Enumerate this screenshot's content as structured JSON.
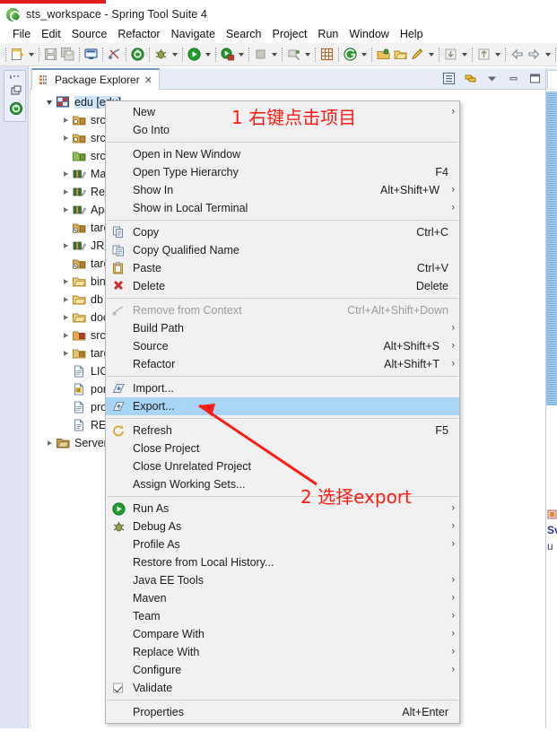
{
  "window": {
    "title": "sts_workspace - Spring Tool Suite 4",
    "app_icon": "spring-logo-icon"
  },
  "menubar": {
    "items": [
      "File",
      "Edit",
      "Source",
      "Refactor",
      "Navigate",
      "Search",
      "Project",
      "Run",
      "Window",
      "Help"
    ]
  },
  "toolbar": {
    "groups": [
      {
        "icons": [
          "new-wizard-icon"
        ],
        "arrow_after": true
      },
      {
        "icons": [
          "save-icon",
          "save-all-icon"
        ],
        "arrow_after": false
      },
      {
        "icons": [
          "console-icon"
        ],
        "arrow_after": false
      },
      {
        "icons": [
          "skip-breakpoints-icon"
        ],
        "arrow_after": false
      },
      {
        "icons": [
          "boot-dashboard-icon"
        ],
        "arrow_after": false
      },
      {
        "icons": [
          "debug-icon"
        ],
        "arrow_after": true
      },
      {
        "icons": [
          "run-icon"
        ],
        "arrow_after": true
      },
      {
        "icons": [
          "run-external-tools-icon"
        ],
        "arrow_after": true
      },
      {
        "icons": [
          "terminate-icon"
        ],
        "arrow_after": true
      },
      {
        "icons": [
          "publish-icon"
        ],
        "arrow_after": true
      },
      {
        "icons": [
          "new-package-icon"
        ],
        "arrow_after": false
      },
      {
        "icons": [
          "git-repo-icon"
        ],
        "arrow_after": true
      },
      {
        "icons": [
          "open-type-icon",
          "open-folder-icon",
          "search-pencil-icon"
        ],
        "arrow_after": true
      },
      {
        "icons": [
          "previous-annotation-icon"
        ],
        "arrow_after": true
      },
      {
        "icons": [
          "next-annotation-icon"
        ],
        "arrow_after": true
      },
      {
        "icons": [
          "back-icon",
          "forward-icon"
        ],
        "arrow_after": true
      },
      {
        "icons": [
          "last-edit-icon"
        ],
        "arrow_after": false
      }
    ]
  },
  "rail": {
    "items": [
      "restore-perspective-icon",
      "boot-dashboard-icon"
    ]
  },
  "explorer": {
    "tab_label": "Package Explorer",
    "tab_icon": "package-explorer-icon",
    "close_glyph": "✕",
    "view_tools": [
      "collapse-all-icon",
      "link-with-editor-icon",
      "view-menu-icon",
      "minimize-icon",
      "maximize-icon"
    ],
    "tree": [
      {
        "indent": 0,
        "twisty": "open",
        "icon": "java-project-icon",
        "label": "edu [edu]"
      },
      {
        "indent": 1,
        "twisty": "closed",
        "icon": "source-folder-icon",
        "label": "src/"
      },
      {
        "indent": 1,
        "twisty": "closed",
        "icon": "source-folder-icon",
        "label": "src/"
      },
      {
        "indent": 1,
        "twisty": "none",
        "icon": "source-folder-warn-icon",
        "label": "src/"
      },
      {
        "indent": 1,
        "twisty": "closed",
        "icon": "library-icon",
        "label": "Mav"
      },
      {
        "indent": 1,
        "twisty": "closed",
        "icon": "library-icon",
        "label": "Refe"
      },
      {
        "indent": 1,
        "twisty": "closed",
        "icon": "library-icon",
        "label": "Apa"
      },
      {
        "indent": 1,
        "twisty": "none",
        "icon": "source-folder-excl-icon",
        "label": "targ"
      },
      {
        "indent": 1,
        "twisty": "closed",
        "icon": "library-icon",
        "label": "JRE "
      },
      {
        "indent": 1,
        "twisty": "none",
        "icon": "source-folder-excl-icon",
        "label": "targ"
      },
      {
        "indent": 1,
        "twisty": "closed",
        "icon": "folder-icon",
        "label": "bin"
      },
      {
        "indent": 1,
        "twisty": "closed",
        "icon": "folder-icon",
        "label": "db"
      },
      {
        "indent": 1,
        "twisty": "closed",
        "icon": "folder-icon",
        "label": "doc"
      },
      {
        "indent": 1,
        "twisty": "closed",
        "icon": "folder-src-icon",
        "label": "src"
      },
      {
        "indent": 1,
        "twisty": "closed",
        "icon": "folder-excl-icon",
        "label": "targ"
      },
      {
        "indent": 1,
        "twisty": "none",
        "icon": "file-icon",
        "label": "LICE"
      },
      {
        "indent": 1,
        "twisty": "none",
        "icon": "pom-file-icon",
        "label": "pom"
      },
      {
        "indent": 1,
        "twisty": "none",
        "icon": "file-icon",
        "label": "prog"
      },
      {
        "indent": 1,
        "twisty": "none",
        "icon": "file-icon",
        "label": "REA"
      },
      {
        "indent": 0,
        "twisty": "closed",
        "icon": "servers-folder-icon",
        "label": "Servers"
      }
    ]
  },
  "right_panel": {
    "icon": "warning-file-icon",
    "line1": "Sv",
    "line2": "u"
  },
  "context_menu": {
    "items": [
      {
        "kind": "item",
        "label": "New",
        "accel": "",
        "submenu": true,
        "icon": "",
        "disabled": false
      },
      {
        "kind": "item",
        "label": "Go Into",
        "accel": "",
        "submenu": false,
        "icon": "",
        "disabled": false
      },
      {
        "kind": "sep"
      },
      {
        "kind": "item",
        "label": "Open in New Window",
        "accel": "",
        "submenu": false,
        "icon": "",
        "disabled": false
      },
      {
        "kind": "item",
        "label": "Open Type Hierarchy",
        "accel": "F4",
        "submenu": false,
        "icon": "",
        "disabled": false
      },
      {
        "kind": "item",
        "label": "Show In",
        "accel": "Alt+Shift+W",
        "submenu": true,
        "icon": "",
        "disabled": false
      },
      {
        "kind": "item",
        "label": "Show in Local Terminal",
        "accel": "",
        "submenu": true,
        "icon": "",
        "disabled": false
      },
      {
        "kind": "sep"
      },
      {
        "kind": "item",
        "label": "Copy",
        "accel": "Ctrl+C",
        "submenu": false,
        "icon": "copy-icon",
        "disabled": false
      },
      {
        "kind": "item",
        "label": "Copy Qualified Name",
        "accel": "",
        "submenu": false,
        "icon": "copy-qualified-icon",
        "disabled": false
      },
      {
        "kind": "item",
        "label": "Paste",
        "accel": "Ctrl+V",
        "submenu": false,
        "icon": "paste-icon",
        "disabled": false
      },
      {
        "kind": "item",
        "label": "Delete",
        "accel": "Delete",
        "submenu": false,
        "icon": "delete-icon",
        "disabled": false
      },
      {
        "kind": "sep"
      },
      {
        "kind": "item",
        "label": "Remove from Context",
        "accel": "Ctrl+Alt+Shift+Down",
        "submenu": false,
        "icon": "remove-context-icon",
        "disabled": true
      },
      {
        "kind": "item",
        "label": "Build Path",
        "accel": "",
        "submenu": true,
        "icon": "",
        "disabled": false
      },
      {
        "kind": "item",
        "label": "Source",
        "accel": "Alt+Shift+S",
        "submenu": true,
        "icon": "",
        "disabled": false
      },
      {
        "kind": "item",
        "label": "Refactor",
        "accel": "Alt+Shift+T",
        "submenu": true,
        "icon": "",
        "disabled": false
      },
      {
        "kind": "sep"
      },
      {
        "kind": "item",
        "label": "Import...",
        "accel": "",
        "submenu": false,
        "icon": "import-icon",
        "disabled": false
      },
      {
        "kind": "item",
        "label": "Export...",
        "accel": "",
        "submenu": false,
        "icon": "export-icon",
        "disabled": false,
        "highlighted": true
      },
      {
        "kind": "sep"
      },
      {
        "kind": "item",
        "label": "Refresh",
        "accel": "F5",
        "submenu": false,
        "icon": "refresh-icon",
        "disabled": false
      },
      {
        "kind": "item",
        "label": "Close Project",
        "accel": "",
        "submenu": false,
        "icon": "",
        "disabled": false
      },
      {
        "kind": "item",
        "label": "Close Unrelated Project",
        "accel": "",
        "submenu": false,
        "icon": "",
        "disabled": false
      },
      {
        "kind": "item",
        "label": "Assign Working Sets...",
        "accel": "",
        "submenu": false,
        "icon": "",
        "disabled": false
      },
      {
        "kind": "sep"
      },
      {
        "kind": "item",
        "label": "Run As",
        "accel": "",
        "submenu": true,
        "icon": "run-icon",
        "disabled": false
      },
      {
        "kind": "item",
        "label": "Debug As",
        "accel": "",
        "submenu": true,
        "icon": "debug-icon",
        "disabled": false
      },
      {
        "kind": "item",
        "label": "Profile As",
        "accel": "",
        "submenu": true,
        "icon": "",
        "disabled": false
      },
      {
        "kind": "item",
        "label": "Restore from Local History...",
        "accel": "",
        "submenu": false,
        "icon": "",
        "disabled": false
      },
      {
        "kind": "item",
        "label": "Java EE Tools",
        "accel": "",
        "submenu": true,
        "icon": "",
        "disabled": false
      },
      {
        "kind": "item",
        "label": "Maven",
        "accel": "",
        "submenu": true,
        "icon": "",
        "disabled": false
      },
      {
        "kind": "item",
        "label": "Team",
        "accel": "",
        "submenu": true,
        "icon": "",
        "disabled": false
      },
      {
        "kind": "item",
        "label": "Compare With",
        "accel": "",
        "submenu": true,
        "icon": "",
        "disabled": false
      },
      {
        "kind": "item",
        "label": "Replace With",
        "accel": "",
        "submenu": true,
        "icon": "",
        "disabled": false
      },
      {
        "kind": "item",
        "label": "Configure",
        "accel": "",
        "submenu": true,
        "icon": "",
        "disabled": false
      },
      {
        "kind": "item",
        "label": "Validate",
        "accel": "",
        "submenu": false,
        "icon": "",
        "checked": true,
        "disabled": false
      },
      {
        "kind": "sep"
      },
      {
        "kind": "item",
        "label": "Properties",
        "accel": "Alt+Enter",
        "submenu": false,
        "icon": "",
        "disabled": false
      }
    ],
    "submenu_glyph": "›"
  },
  "annotations": [
    {
      "text": "1 右键点击项目",
      "color": "#ff1a12"
    },
    {
      "text": "2 选择export",
      "color": "#ff1a12"
    }
  ],
  "colors": {
    "accent": "#ff1a12",
    "highlight": "#a8d4f5",
    "menu_bg": "#f1f1f1",
    "rail_bg": "#dfe3f2",
    "tab_bg": "#e7ecf7"
  }
}
